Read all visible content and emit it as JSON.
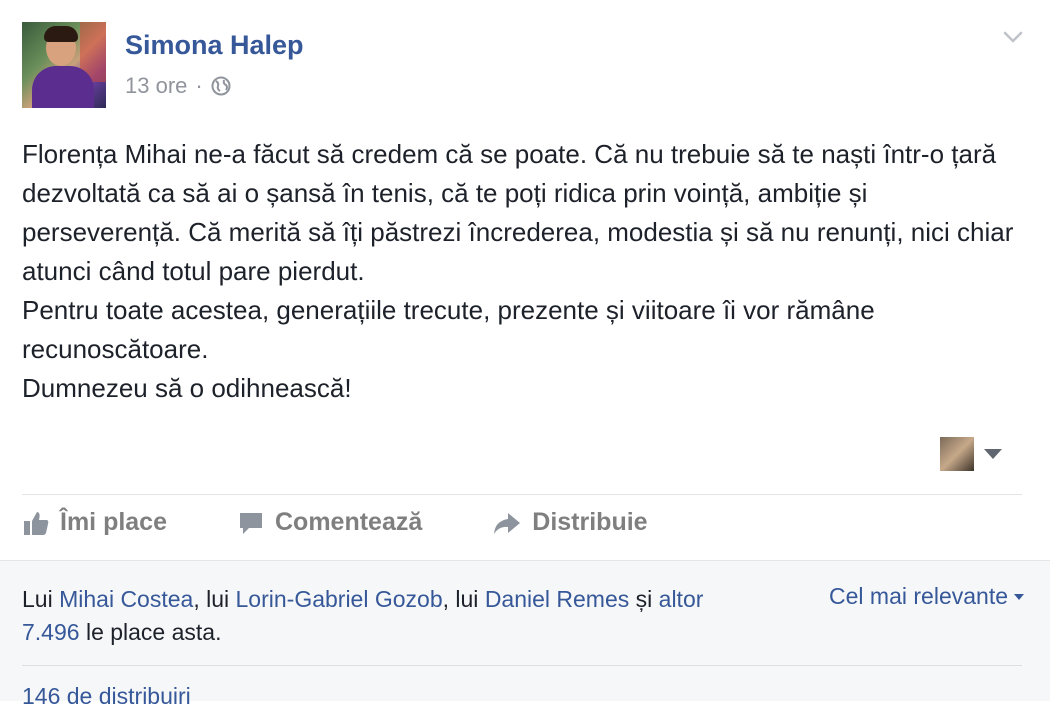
{
  "post": {
    "author": "Simona Halep",
    "time": "13 ore",
    "separator": "·",
    "paragraphs": [
      "Florența Mihai ne-a făcut să credem că se poate. Că nu trebuie să te naști într-o țară dezvoltată ca să ai o șansă în tenis, că te poți ridica prin voință, ambiție și perseverență. Că merită să îți păstrezi încrederea, modestia și să nu renunți, nici chiar atunci când totul pare pierdut.",
      "Pentru toate acestea, generațiile trecute, prezente și viitoare îi vor rămâne recunoscătoare.",
      "Dumnezeu să o odihnească!"
    ]
  },
  "actions": {
    "like": "Îmi place",
    "comment": "Comentează",
    "share": "Distribuie"
  },
  "likes": {
    "prefix": "Lui ",
    "user1": "Mihai Costea",
    "sep1": ", lui ",
    "user2": "Lorin-Gabriel Gozob",
    "sep2": ", lui ",
    "user3": "Daniel Remes",
    "sep3": " și ",
    "others": "altor 7.496",
    "suffix": " le place asta."
  },
  "sort": {
    "label": "Cel mai relevante"
  },
  "shares": {
    "label": "146 de distribuiri"
  },
  "colors": {
    "link": "#365899",
    "meta": "#90949c",
    "action": "#7f7f7f",
    "footer_bg": "#f6f7f9"
  },
  "icons": [
    "globe-icon",
    "chevron-down-icon",
    "like-icon",
    "comment-icon",
    "share-icon",
    "caret-down-icon"
  ]
}
